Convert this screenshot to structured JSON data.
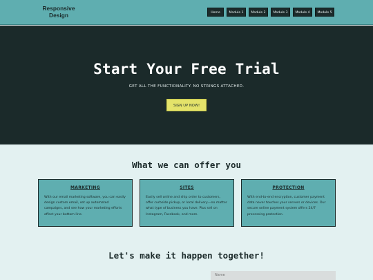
{
  "header": {
    "logo_line1": "Responsive",
    "logo_line2": "Design",
    "nav": [
      "Home",
      "Module 1",
      "Module 2",
      "Module 3",
      "Module 4",
      "Module 5"
    ]
  },
  "hero": {
    "title": "Start Your Free Trial",
    "subtitle": "GET ALL THE FUNCTIONALITY. NO STRINGS ATTACHED.",
    "cta": "SIGN UP NOW!"
  },
  "offer": {
    "title": "What we can offer you",
    "cards": [
      {
        "title": "MARKETING",
        "body": "With our email marketing software, you can easily design custom email, set up automated campaigns, and see how your marketing efforts affect your bottom line."
      },
      {
        "title": "SITES",
        "body": "Easily sell online and ship order to customers, offer curbside pickup, or local delivery—no matter what type of business you have. Plus sell on Instagram, Facebook, and more."
      },
      {
        "title": "PROTECTION",
        "body": "With end-to-end encryption, customer payment data never touches your servers or devices. Our secure online payment system offers 24/7 processing protection."
      }
    ]
  },
  "contact": {
    "title": "Let's make it happen together!",
    "name_placeholder": "Name"
  },
  "colors": {
    "teal": "#5faeb0",
    "dark": "#1b2a2a",
    "cta_yellow": "#e4e36a",
    "page_bg": "#e3f1f1"
  }
}
